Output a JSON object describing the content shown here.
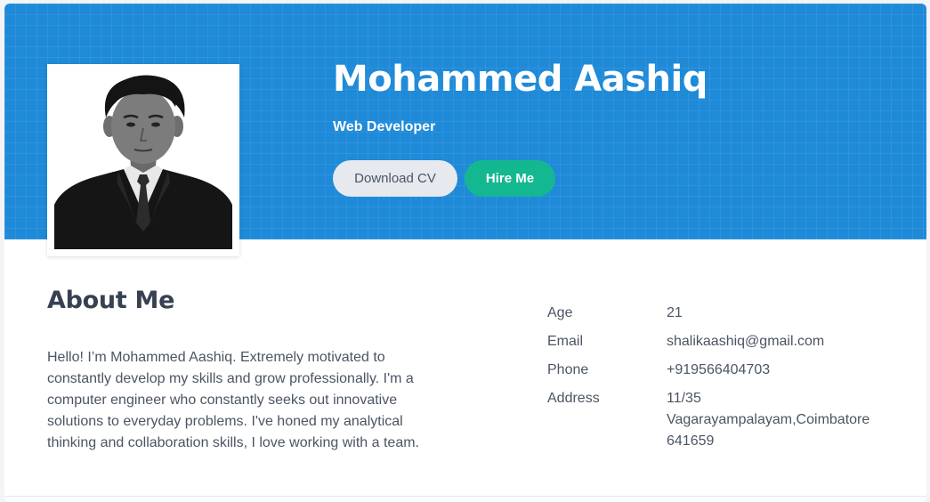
{
  "profile": {
    "name": "Mohammed Aashiq",
    "role": "Web Developer",
    "photo_alt": "Mohammed Aashiq"
  },
  "buttons": {
    "download_cv": "Download CV",
    "hire_me": "Hire Me"
  },
  "about": {
    "title": "About Me",
    "text": "Hello! I’m Mohammed Aashiq. Extremely motivated to constantly develop my skills and grow professionally. I'm a computer engineer who constantly seeks out innovative solutions to everyday problems. I've honed my analytical thinking and collaboration skills, I love working with a team."
  },
  "info": {
    "age_label": "Age",
    "age_value": "21",
    "email_label": "Email",
    "email_value": "shalikaashiq@gmail.com",
    "phone_label": "Phone",
    "phone_value": "+919566404703",
    "address_label": "Address",
    "address_value": "11/35 Vagarayampalayam,Coimbatore 641659"
  },
  "colors": {
    "hero": "#1f8ad8",
    "hire_button": "#14b890",
    "cv_button": "#e6e9ee",
    "text": "#4b5563"
  }
}
